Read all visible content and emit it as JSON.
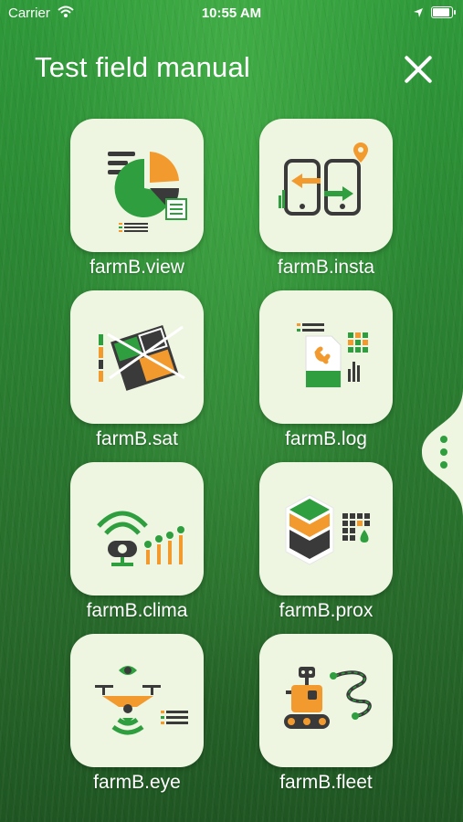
{
  "status_bar": {
    "carrier": "Carrier",
    "time": "10:55 AM",
    "battery_level": 1.0
  },
  "header": {
    "title": "Test field manual"
  },
  "apps": [
    {
      "label": "farmB.view"
    },
    {
      "label": "farmB.insta"
    },
    {
      "label": "farmB.sat"
    },
    {
      "label": "farmB.log"
    },
    {
      "label": "farmB.clima"
    },
    {
      "label": "farmB.prox"
    },
    {
      "label": "farmB.eye"
    },
    {
      "label": "farmB.fleet"
    }
  ],
  "colors": {
    "green": "#2e9e3e",
    "orange": "#f29a2e",
    "dark": "#3a3a3a",
    "tile": "#eef6e2"
  }
}
